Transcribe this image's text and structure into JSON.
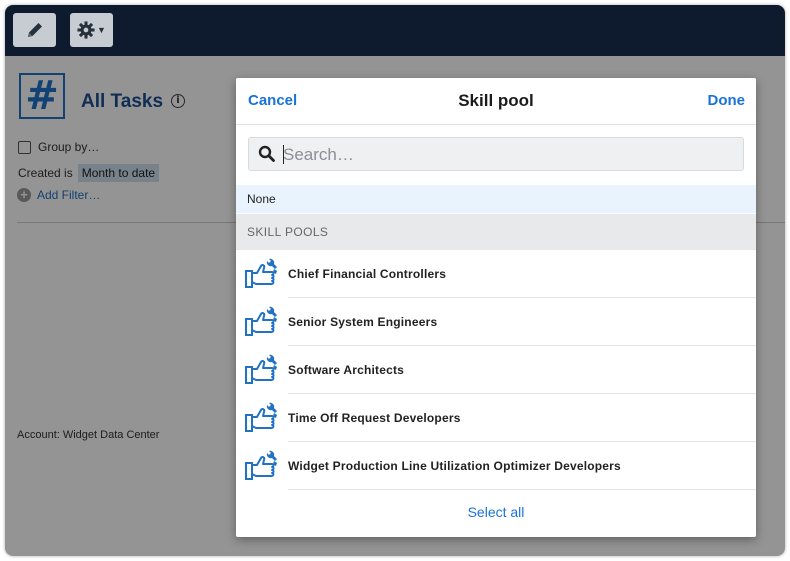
{
  "toolbar": {
    "edit_icon": "pencil-icon",
    "settings_icon": "gear-icon",
    "dropdown_caret": "▼"
  },
  "page": {
    "title": "All Tasks",
    "title_icon": "hash-icon",
    "info_glyph": "i",
    "group_by_label": "Group by…",
    "created_label": "Created is",
    "created_value": "Month to date",
    "add_filter_label": "Add Filter…",
    "account_label": "Account: Widget Data Center"
  },
  "modal": {
    "cancel_label": "Cancel",
    "title": "Skill pool",
    "done_label": "Done",
    "search_placeholder": "Search…",
    "none_label": "None",
    "section_header": "SKILL POOLS",
    "items": [
      {
        "label": "Chief Financial Controllers"
      },
      {
        "label": "Senior System Engineers"
      },
      {
        "label": "Software Architects"
      },
      {
        "label": "Time Off Request Developers"
      },
      {
        "label": "Widget Production Line Utilization Optimizer Developers"
      }
    ],
    "select_all_label": "Select all"
  },
  "colors": {
    "topbar": "#0e1a2e",
    "accent_blue": "#1a73d9",
    "title_blue": "#1d4f91",
    "pool_icon_blue": "#2272c3"
  }
}
